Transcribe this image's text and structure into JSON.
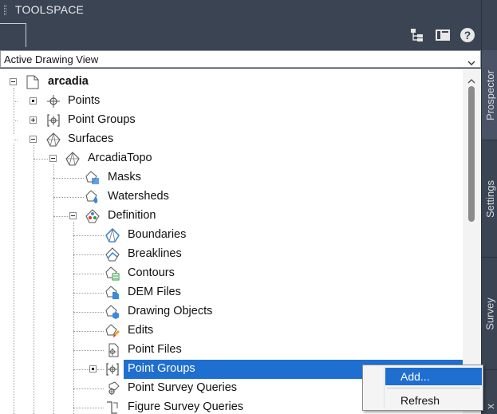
{
  "window": {
    "title": "TOOLSPACE"
  },
  "toolbar": {
    "icons": [
      "item-view-icon",
      "panorama-icon",
      "help-icon"
    ]
  },
  "view_selector": {
    "selected": "Active Drawing View"
  },
  "tree": {
    "root": "arcadia",
    "nodes": {
      "points": "Points",
      "point_groups": "Point Groups",
      "surfaces": "Surfaces",
      "arcadia_topo": "ArcadiaTopo",
      "masks": "Masks",
      "watersheds": "Watersheds",
      "definition": "Definition",
      "boundaries": "Boundaries",
      "breaklines": "Breaklines",
      "contours": "Contours",
      "dem_files": "DEM Files",
      "drawing_objects": "Drawing Objects",
      "edits": "Edits",
      "point_files": "Point Files",
      "def_point_groups": "Point Groups",
      "point_survey_queries": "Point Survey Queries",
      "figure_survey_queries": "Figure Survey Queries"
    },
    "selected_node": "Point Groups"
  },
  "context_menu": {
    "items": [
      "Add...",
      "Refresh"
    ],
    "highlighted": "Add..."
  },
  "side_tabs": {
    "prospector": "Prospector",
    "settings": "Settings",
    "survey": "Survey",
    "partial": "x"
  },
  "colors": {
    "panel_bg": "#3b4453",
    "selection": "#1f6fd0",
    "tree_bg": "#ffffff"
  }
}
